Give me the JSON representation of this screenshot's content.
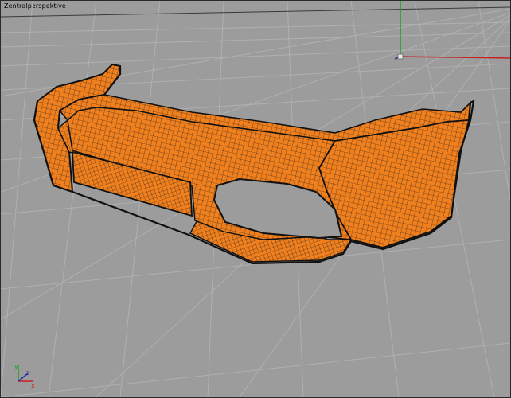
{
  "viewport": {
    "title": "Zentralperspektive",
    "projection": "perspective",
    "background_color": "#9c9c9c",
    "grid_color": "#b0b0b0",
    "horizon_color": "#3a3a3a"
  },
  "world_axes": {
    "x_color": "#c81e1e",
    "y_color": "#1ea01e",
    "z_color": "#2a2aaa"
  },
  "corner_axis_gizmo": {
    "labels": [
      "y",
      "z",
      "x"
    ],
    "y_color": "#1ea01e",
    "z_color": "#2a2aaa",
    "x_color": "#c81e1e"
  },
  "model": {
    "name": "front-bumper",
    "display_mode": "wireframe-shaded",
    "surface_color": "#f07f1e",
    "wire_color": "#1a1a1a"
  }
}
